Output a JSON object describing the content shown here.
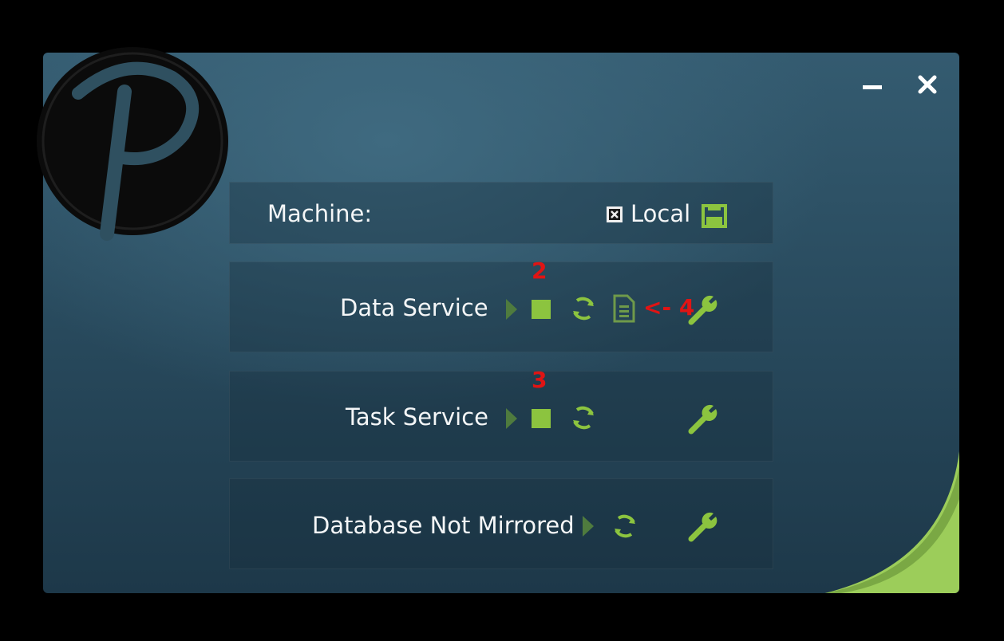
{
  "window": {
    "minimize_icon": "minimize-icon",
    "close_icon": "close-icon",
    "logo_icon": "p-logo-icon"
  },
  "machine": {
    "label": "Machine:",
    "value": "Local",
    "checkbox_state": "checked",
    "save_icon": "floppy-save-icon"
  },
  "services": [
    {
      "name": "Data Service",
      "controls": [
        "play-icon",
        "stop-icon",
        "refresh-icon",
        "log-file-icon",
        "wrench-icon"
      ]
    },
    {
      "name": "Task Service",
      "controls": [
        "play-icon",
        "stop-icon",
        "refresh-icon",
        "wrench-icon"
      ]
    },
    {
      "name": "Database Not Mirrored",
      "controls": [
        "play-icon",
        "refresh-icon",
        "wrench-icon"
      ]
    }
  ],
  "annotations": {
    "a2": "2",
    "a3": "3",
    "a4": "<- 4"
  },
  "colors": {
    "accent_green": "#8cc43f",
    "dim_green": "#5e8d3a",
    "annotation_red": "#e01414",
    "background": "#2a4a5e"
  }
}
